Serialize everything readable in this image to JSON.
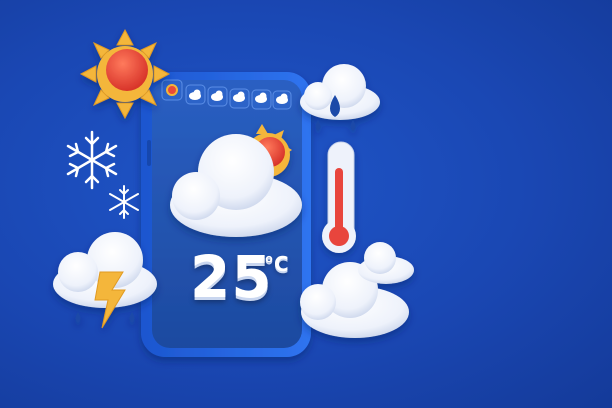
{
  "weather_card": {
    "temperature": "25",
    "unit": "°C"
  },
  "forecast_strip": {
    "icons": [
      "sun-icon",
      "cloud-icon",
      "cloud-snow-icon",
      "cloud-rain-icon",
      "cloud-rain-icon",
      "cloud-icon"
    ]
  },
  "colors": {
    "background": "#1a47b3",
    "phone_frame": "#1f5fd6",
    "phone_screen": "#1d4fa8",
    "sun": "#f4b63a",
    "sun_core": "#e94a3a",
    "thermometer_fill": "#e8453c"
  }
}
